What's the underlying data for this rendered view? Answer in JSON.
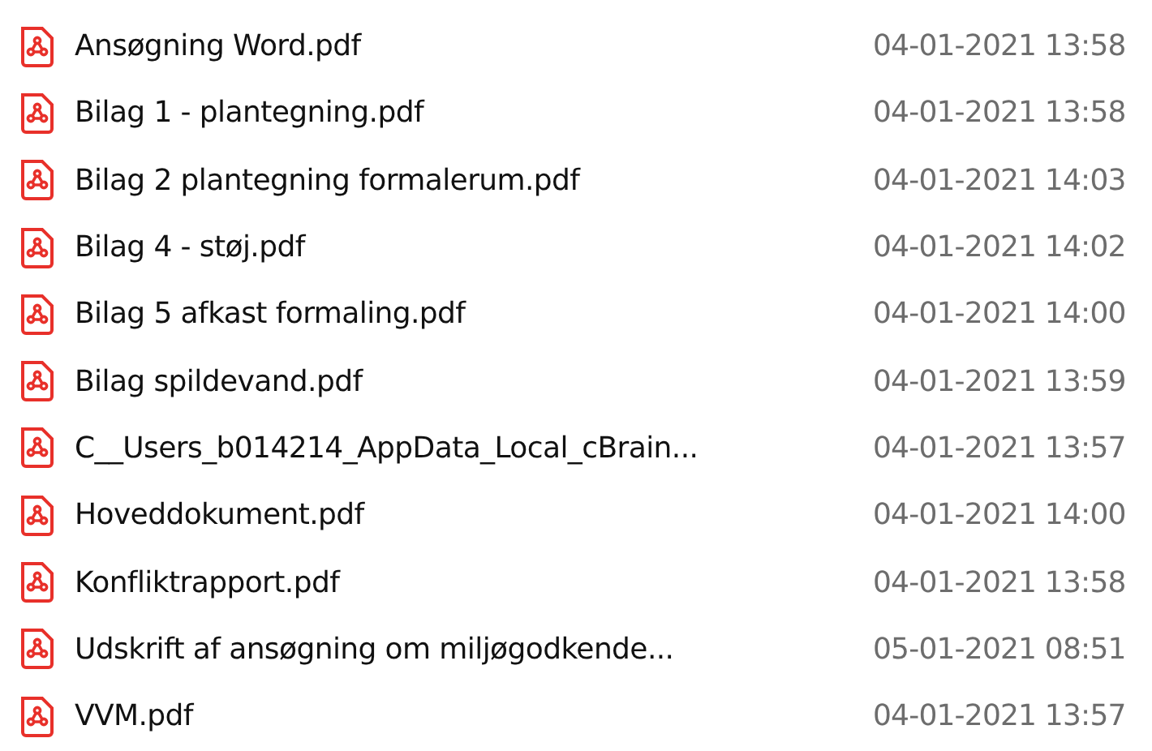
{
  "files": [
    {
      "name": "Ansøgning Word.pdf",
      "modified": "04-01-2021 13:58"
    },
    {
      "name": "Bilag 1 - plantegning.pdf",
      "modified": "04-01-2021 13:58"
    },
    {
      "name": "Bilag 2 plantegning formalerum.pdf",
      "modified": "04-01-2021 14:03"
    },
    {
      "name": "Bilag 4 - støj.pdf",
      "modified": "04-01-2021 14:02"
    },
    {
      "name": "Bilag 5 afkast formaling.pdf",
      "modified": "04-01-2021 14:00"
    },
    {
      "name": "Bilag spildevand.pdf",
      "modified": "04-01-2021 13:59"
    },
    {
      "name": "C__Users_b014214_AppData_Local_cBrain...",
      "modified": "04-01-2021 13:57"
    },
    {
      "name": "Hoveddokument.pdf",
      "modified": "04-01-2021 14:00"
    },
    {
      "name": "Konfliktrapport.pdf",
      "modified": "04-01-2021 13:58"
    },
    {
      "name": "Udskrift af ansøgning om miljøgodkende...",
      "modified": "05-01-2021 08:51"
    },
    {
      "name": "VVM.pdf",
      "modified": "04-01-2021 13:57"
    }
  ]
}
